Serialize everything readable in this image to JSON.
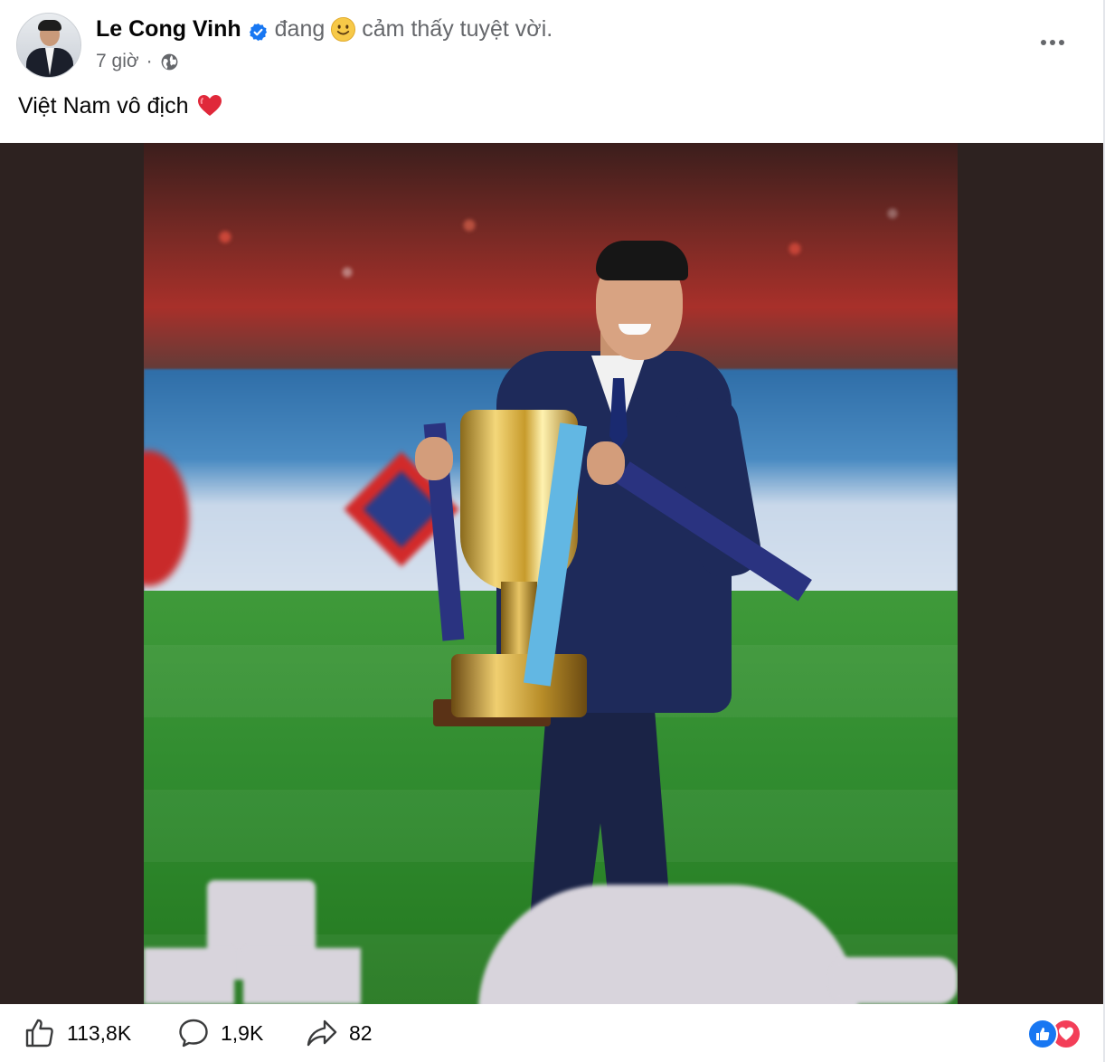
{
  "author": {
    "name": "Le Cong Vinh",
    "feeling_prefix": "đang",
    "feeling_text": "cảm thấy tuyệt vời."
  },
  "post": {
    "time": "7 giờ",
    "separator": "·",
    "text": "Việt Nam vô địch"
  },
  "stats": {
    "likes": "113,8K",
    "comments": "1,9K",
    "shares": "82"
  },
  "colors": {
    "verified": "#1877f2",
    "like_reaction": "#1877f2",
    "love_reaction": "#f33e58",
    "secondary_text": "#65676b",
    "media_backdrop": "#2d2220"
  },
  "icons": {
    "verified": "verified-badge-icon",
    "feeling": "smiling-face-emoji",
    "privacy": "globe-icon",
    "more": "more-options-icon",
    "post_emoji": "red-heart-emoji",
    "like": "thumbs-up-icon",
    "comment": "comment-bubble-icon",
    "share": "share-arrow-icon"
  }
}
